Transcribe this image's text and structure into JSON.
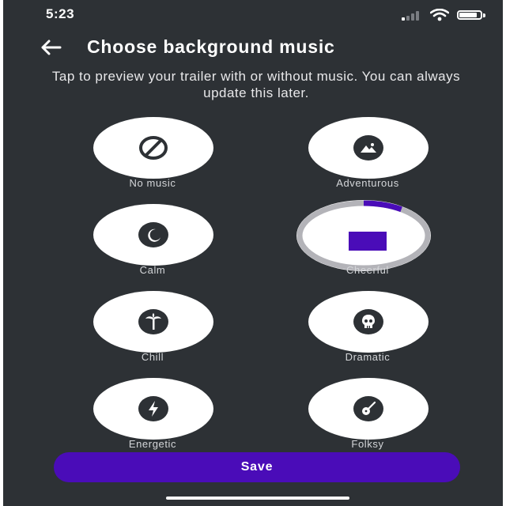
{
  "status_bar": {
    "time": "5:23"
  },
  "header": {
    "title": "Choose background music"
  },
  "subtitle": "Tap to preview your trailer with or without music. You can always update this later.",
  "options": [
    {
      "label": "No music",
      "icon": "no-music-icon"
    },
    {
      "label": "Adventurous",
      "icon": "landscape-icon"
    },
    {
      "label": "Calm",
      "icon": "moon-icon"
    },
    {
      "label": "Cheerful",
      "icon": "stop-icon",
      "playing": true,
      "progress": 0.1
    },
    {
      "label": "Chill",
      "icon": "palm-tree-icon"
    },
    {
      "label": "Dramatic",
      "icon": "skull-icon"
    },
    {
      "label": "Energetic",
      "icon": "lightning-icon"
    },
    {
      "label": "Folksy",
      "icon": "guitar-icon"
    }
  ],
  "save_label": "Save",
  "colors": {
    "background": "#2d3135",
    "accent": "#4a0cb8",
    "circle": "#ffffff"
  }
}
